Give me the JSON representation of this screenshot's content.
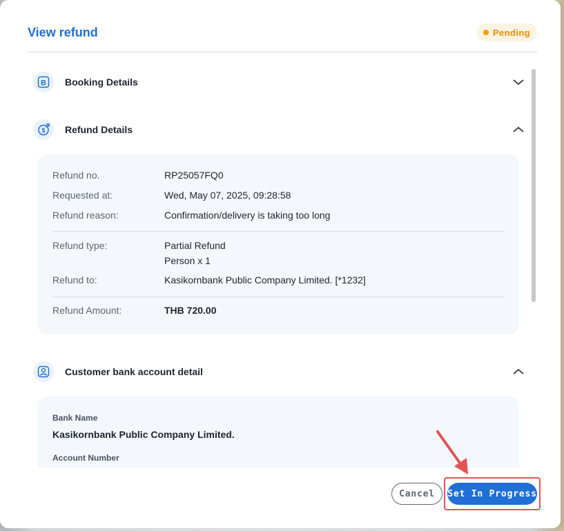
{
  "modal": {
    "title": "View refund",
    "status": "Pending",
    "status_color": "#f08c00"
  },
  "sections": {
    "booking": {
      "title": "Booking Details",
      "icon": "booking-b-icon",
      "expanded": false
    },
    "refund": {
      "title": "Refund Details",
      "icon": "refund-dollar-icon",
      "expanded": true
    },
    "bank": {
      "title": "Customer bank account detail",
      "icon": "customer-account-icon",
      "expanded": true
    }
  },
  "refund_details": {
    "refund_no_label": "Refund no.",
    "refund_no": "RP25057FQ0",
    "requested_at_label": "Requested at:",
    "requested_at": "Wed, May 07, 2025, 09:28:58",
    "reason_label": "Refund reason:",
    "reason": "Confirmation/delivery is taking too long",
    "type_label": "Refund type:",
    "type": "Partial Refund",
    "type_detail": "Person x 1",
    "to_label": "Refund to:",
    "to": "Kasikornbank Public Company Limited. [*1232]",
    "amount_label": "Refund Amount:",
    "amount": "THB 720.00"
  },
  "bank_details": {
    "bank_name_label": "Bank Name",
    "bank_name": "Kasikornbank Public Company Limited.",
    "account_number_label": "Account Number"
  },
  "footer": {
    "cancel_label": "Cancel",
    "set_in_progress_label": "Set In Progress"
  },
  "colors": {
    "accent": "#1f6fd6",
    "highlight": "#e25454"
  }
}
